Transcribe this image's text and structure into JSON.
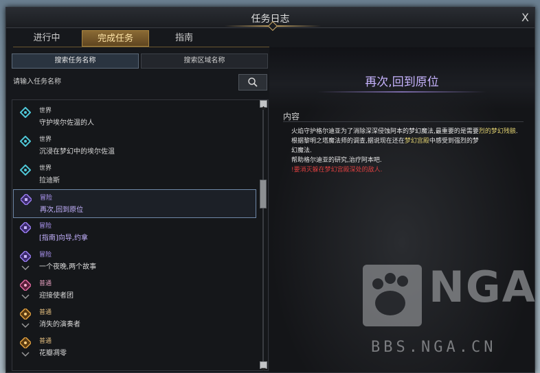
{
  "window": {
    "title": "任务日志",
    "close_label": "X"
  },
  "tabs": [
    {
      "label": "进行中"
    },
    {
      "label": "完成任务"
    },
    {
      "label": "指南"
    }
  ],
  "search_modes": [
    {
      "label": "搜索任务名称"
    },
    {
      "label": "搜索区域名称"
    }
  ],
  "search": {
    "placeholder": "请输入任务名称"
  },
  "quests": [
    {
      "type": "世界",
      "name": "守护埃尔佐温的人",
      "icon": "world-quest-icon",
      "color": "#4fc8d8"
    },
    {
      "type": "世界",
      "name": "沉浸在梦幻中的埃尔佐温",
      "icon": "world-quest-icon",
      "color": "#4fc8d8"
    },
    {
      "type": "世界",
      "name": "拉迪斯",
      "icon": "world-quest-icon",
      "color": "#4fc8d8"
    },
    {
      "type": "冒险",
      "name": "再次,回到原位",
      "icon": "adventure-quest-icon",
      "color": "#9a7cf0"
    },
    {
      "type": "冒险",
      "name": "[指南]向导,约拿",
      "icon": "adventure-quest-icon",
      "color": "#9a7cf0"
    },
    {
      "type": "冒险",
      "name": "一个夜晚,两个故事",
      "icon": "adventure-quest-icon",
      "color": "#9a7cf0"
    },
    {
      "type": "普通",
      "name": "迎接使者团",
      "icon": "normal-quest-icon",
      "color": "#e06aa0"
    },
    {
      "type": "普通",
      "name": "消失的演奏者",
      "icon": "normal-quest-icon",
      "color": "#e0a040"
    },
    {
      "type": "普通",
      "name": "花瓣凋零",
      "icon": "normal-quest-icon",
      "color": "#e0a040"
    }
  ],
  "detail": {
    "title": "再次,回到原位",
    "content_label": "内容",
    "line1a": "火焰守护格尔迪亚为了消除深深侵蚀阿本的梦幻魔法,最重要的是需要",
    "line1b": "烈的梦幻残骸",
    "line1c": ".",
    "line2a": "根据黎明之塔魔法师的调查,据说现在还在",
    "line2b": "梦幻宫殿",
    "line2c": "中感受到强烈的梦",
    "line2d": "幻魔法.",
    "line3": "帮助格尔迪亚的研究,治疗阿本吧.",
    "line4": "!要消灭躲在梦幻宫殿深处的敌人."
  },
  "watermark": {
    "logo_text": "NGA",
    "site": "BBS.NGA.CN"
  }
}
